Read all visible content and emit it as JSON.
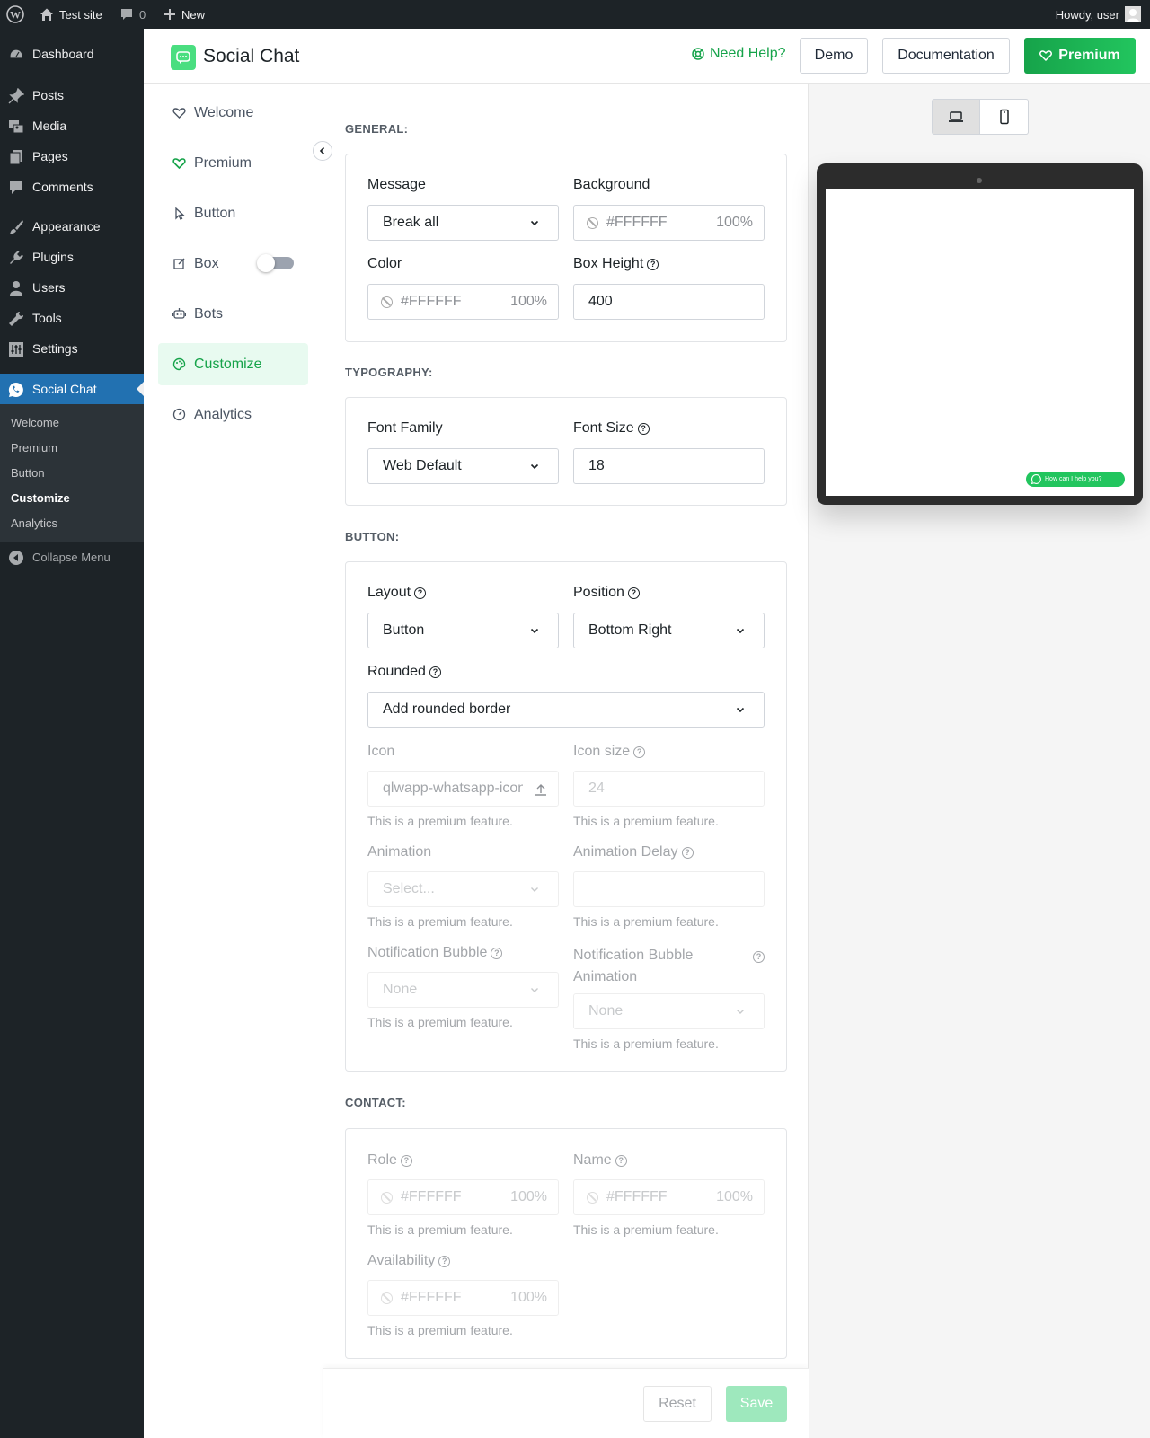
{
  "adminbar": {
    "site_name": "Test site",
    "comments_count": "0",
    "new_label": "New",
    "howdy": "Howdy, user"
  },
  "admin_menu": {
    "items": [
      {
        "label": "Dashboard",
        "icon": "dashboard-icon"
      },
      {
        "label": "Posts",
        "icon": "pin-icon"
      },
      {
        "label": "Media",
        "icon": "media-icon"
      },
      {
        "label": "Pages",
        "icon": "page-icon"
      },
      {
        "label": "Comments",
        "icon": "comment-icon"
      },
      {
        "label": "Appearance",
        "icon": "brush-icon"
      },
      {
        "label": "Plugins",
        "icon": "plug-icon"
      },
      {
        "label": "Users",
        "icon": "user-icon"
      },
      {
        "label": "Tools",
        "icon": "wrench-icon"
      },
      {
        "label": "Settings",
        "icon": "sliders-icon"
      },
      {
        "label": "Social Chat",
        "icon": "whatsapp-icon"
      }
    ],
    "submenu": [
      "Welcome",
      "Premium",
      "Button",
      "Customize",
      "Analytics"
    ],
    "collapse_label": "Collapse Menu"
  },
  "plugin": {
    "title": "Social Chat",
    "nav": [
      "Welcome",
      "Premium",
      "Button",
      "Box",
      "Bots",
      "Customize",
      "Analytics"
    ],
    "header": {
      "help": "Need Help?",
      "demo": "Demo",
      "docs": "Documentation",
      "premium": "Premium"
    }
  },
  "general": {
    "heading": "GENERAL:",
    "message_label": "Message",
    "message_value": "Break all",
    "background_label": "Background",
    "background_value": "#FFFFFF",
    "background_opacity": "100%",
    "color_label": "Color",
    "color_value": "#FFFFFF",
    "color_opacity": "100%",
    "box_height_label": "Box Height",
    "box_height_value": "400"
  },
  "typography": {
    "heading": "TYPOGRAPHY:",
    "font_family_label": "Font Family",
    "font_family_value": "Web Default",
    "font_size_label": "Font Size",
    "font_size_value": "18"
  },
  "button": {
    "heading": "BUTTON:",
    "layout_label": "Layout",
    "layout_value": "Button",
    "position_label": "Position",
    "position_value": "Bottom Right",
    "rounded_label": "Rounded",
    "rounded_value": "Add rounded border",
    "icon_label": "Icon",
    "icon_value": "qlwapp-whatsapp-icon",
    "icon_size_label": "Icon size",
    "icon_size_placeholder": "24",
    "animation_label": "Animation",
    "animation_value": "Select...",
    "animation_delay_label": "Animation Delay",
    "bubble_label": "Notification Bubble",
    "bubble_value": "None",
    "bubble_anim_label_1": "Notification Bubble",
    "bubble_anim_label_2": "Animation",
    "bubble_anim_value": "None",
    "premium_note": "This is a premium feature."
  },
  "contact": {
    "heading": "CONTACT:",
    "role_label": "Role",
    "name_label": "Name",
    "availability_label": "Availability",
    "color_value": "#FFFFFF",
    "opacity": "100%"
  },
  "footer": {
    "reset": "Reset",
    "save": "Save"
  },
  "preview": {
    "bubble_text": "How can I help you?"
  },
  "colors": {
    "accent": "#16a34a",
    "wp_blue": "#2271b1",
    "admin_dark": "#1d2327",
    "premium_gradient": [
      "#16a34a",
      "#22c55e"
    ]
  }
}
